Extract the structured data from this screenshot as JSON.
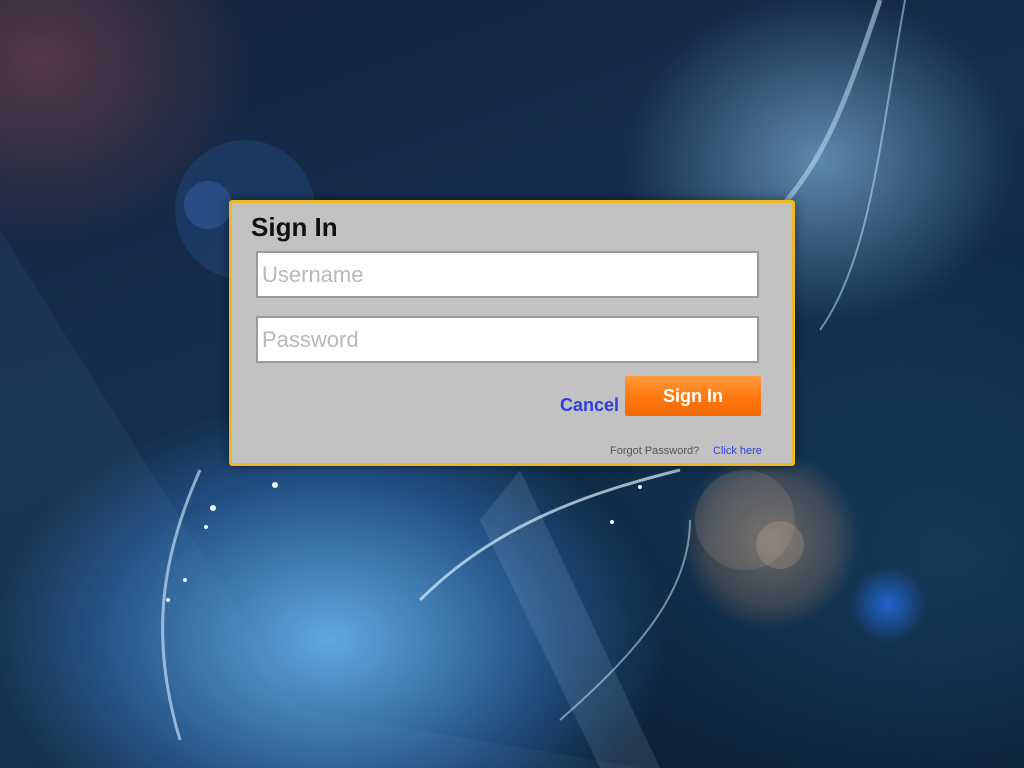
{
  "dialog": {
    "title": "Sign In",
    "username": {
      "placeholder": "Username",
      "value": ""
    },
    "password": {
      "placeholder": "Password",
      "value": ""
    },
    "cancel_label": "Cancel",
    "signin_label": "Sign In",
    "forgot_label": "Forgot Password?",
    "click_here_label": "Click here"
  },
  "colors": {
    "dialog_background": "#c2c2c2",
    "dialog_border": "#f0b820",
    "signin_button": "#ff7a12",
    "link": "#2a3fe0"
  }
}
